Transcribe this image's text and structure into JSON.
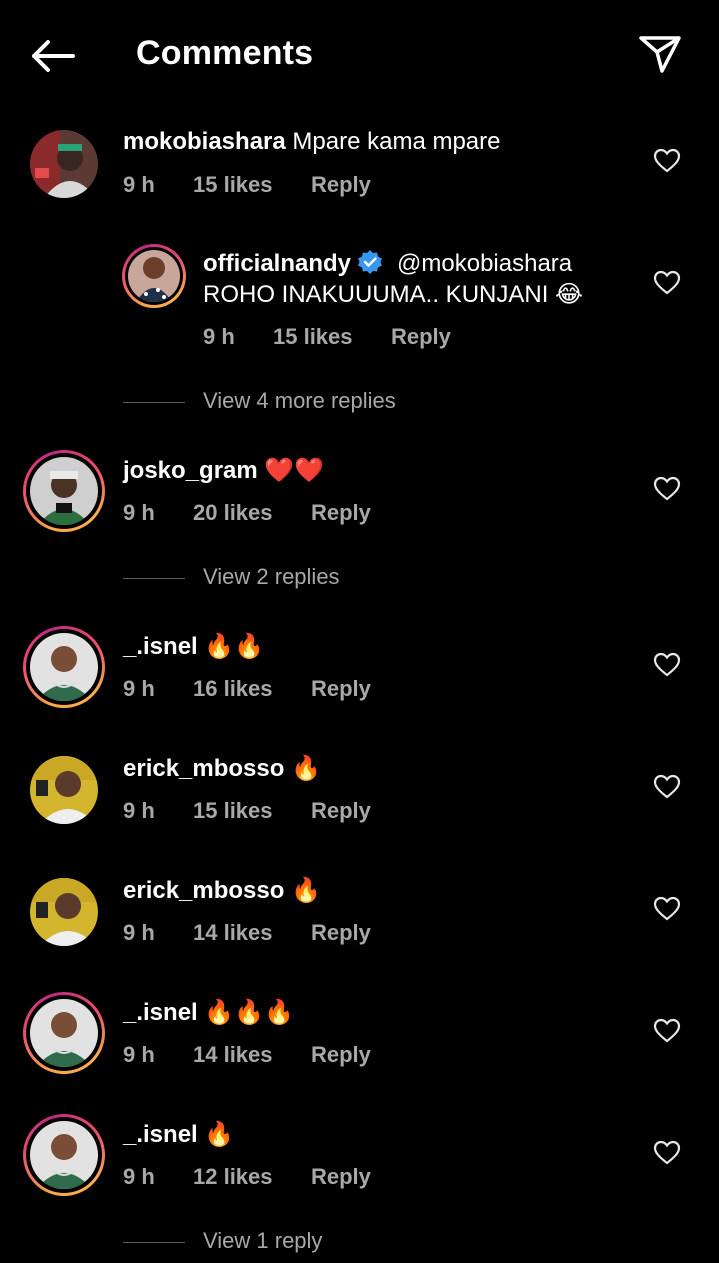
{
  "header": {
    "title": "Comments",
    "back_icon": "arrow-left-icon",
    "share_icon": "paper-plane-icon"
  },
  "colors": {
    "background": "#000000",
    "text": "#ffffff",
    "secondary_text": "#a8a8a8",
    "verified": "#3897f0"
  },
  "comments": [
    {
      "username": "mokobiashara",
      "text": "Mpare kama mpare",
      "time": "9 h",
      "likes": "15 likes",
      "reply": "Reply"
    },
    {
      "username": "officialnandy",
      "mention": "@mokobiashara",
      "text": "ROHO INAKUUUMA.. KUNJANI 😂",
      "time": "9 h",
      "likes": "15 likes",
      "reply": "Reply",
      "verified": true
    },
    {
      "view_replies": "View 4 more replies"
    },
    {
      "username": "josko_gram",
      "text": "❤️❤️",
      "time": "9 h",
      "likes": "20 likes",
      "reply": "Reply"
    },
    {
      "view_replies": "View 2 replies"
    },
    {
      "username": "_.isnel",
      "text": "🔥🔥",
      "time": "9 h",
      "likes": "16 likes",
      "reply": "Reply"
    },
    {
      "username": "erick_mbosso",
      "text": "🔥",
      "time": "9 h",
      "likes": "15 likes",
      "reply": "Reply"
    },
    {
      "username": "erick_mbosso",
      "text": "🔥",
      "time": "9 h",
      "likes": "14 likes",
      "reply": "Reply"
    },
    {
      "username": "_.isnel",
      "text": "🔥🔥🔥",
      "time": "9 h",
      "likes": "14 likes",
      "reply": "Reply"
    },
    {
      "username": "_.isnel",
      "text": "🔥",
      "time": "9 h",
      "likes": "12 likes",
      "reply": "Reply"
    },
    {
      "view_replies": "View 1 reply"
    }
  ]
}
